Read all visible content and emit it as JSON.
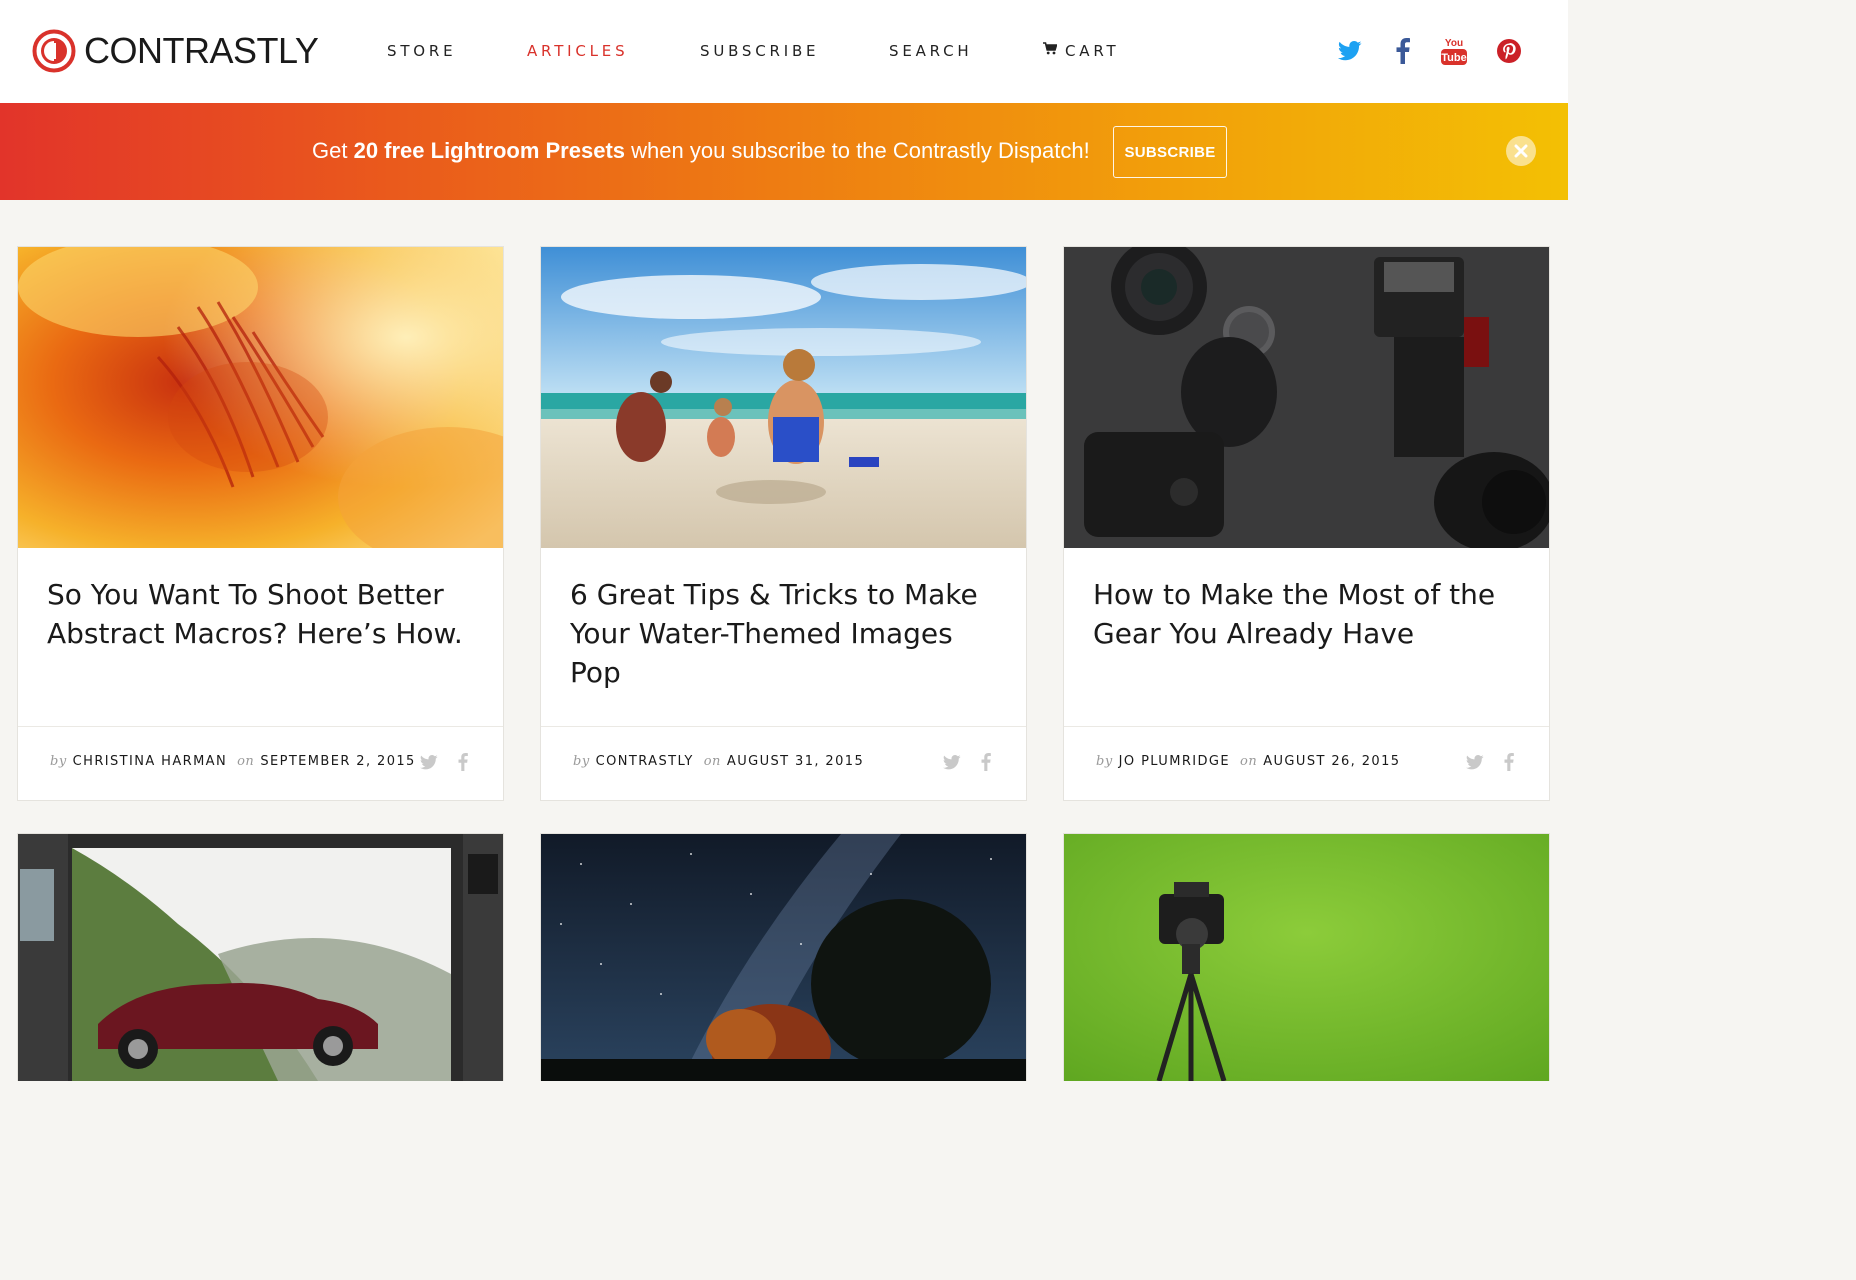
{
  "brand": {
    "name": "CONTRASTLY",
    "accent_color": "#d9322b"
  },
  "nav": {
    "items": [
      {
        "label": "STORE",
        "active": false
      },
      {
        "label": "ARTICLES",
        "active": true
      },
      {
        "label": "SUBSCRIBE",
        "active": false
      },
      {
        "label": "SEARCH",
        "active": false
      },
      {
        "label": "CART",
        "active": false,
        "icon": "cart-icon"
      }
    ]
  },
  "social": [
    {
      "name": "twitter-icon",
      "color": "#1da1f2"
    },
    {
      "name": "facebook-icon",
      "color": "#3b5998"
    },
    {
      "name": "youtube-icon",
      "color": "#d9322b",
      "text_top": "You",
      "text_bottom": "Tube"
    },
    {
      "name": "pinterest-icon",
      "color": "#cb2027"
    }
  ],
  "banner": {
    "prefix": "Get ",
    "highlight": "20 free Lightroom Presets",
    "suffix": " when you subscribe to the Contrastly Dispatch!",
    "button_label": "SUBSCRIBE",
    "close_icon": "close-icon"
  },
  "meta_labels": {
    "by": "by",
    "on": "on"
  },
  "articles": [
    {
      "title": "So You Want To Shoot Better Abstract Macros? Here’s How.",
      "author": "CHRISTINA HARMAN",
      "date": "SEPTEMBER 2, 2015",
      "image": "abstract-macro-flower-photo"
    },
    {
      "title": "6 Great Tips & Tricks to Make Your Water-Themed Images Pop",
      "author": "CONTRASTLY",
      "date": "AUGUST 31, 2015",
      "image": "beach-children-photo"
    },
    {
      "title": "How to Make the Most of the Gear You Already Have",
      "author": "JO PLUMRIDGE",
      "date": "AUGUST 26, 2015",
      "image": "camera-gear-photo"
    },
    {
      "title": "",
      "author": "",
      "date": "",
      "image": "lightroom-car-photo"
    },
    {
      "title": "",
      "author": "",
      "date": "",
      "image": "milky-way-night-photo"
    },
    {
      "title": "",
      "author": "",
      "date": "",
      "image": "green-screen-camera-photo"
    }
  ]
}
